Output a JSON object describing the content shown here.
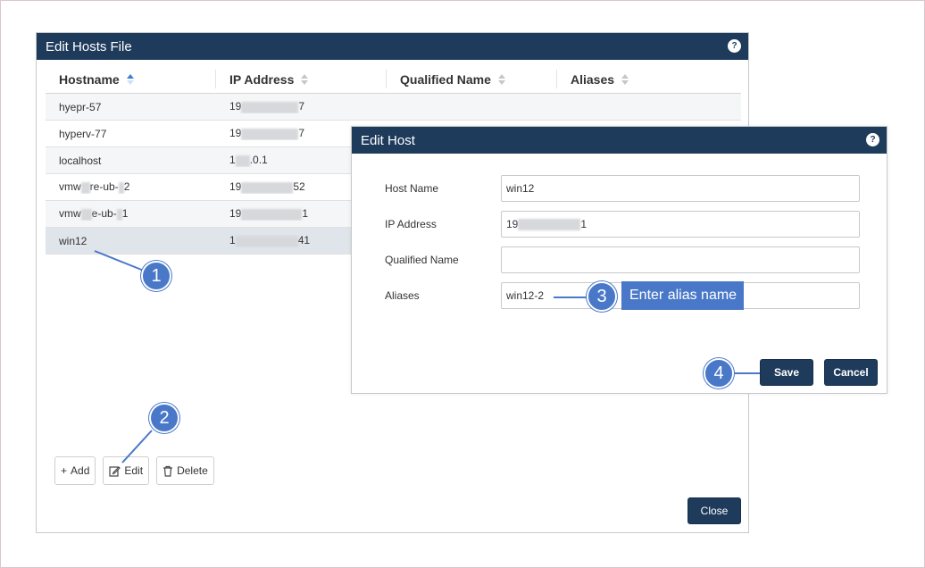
{
  "main_dialog": {
    "title": "Edit Hosts File",
    "help_icon": "?",
    "columns": [
      "Hostname",
      "IP Address",
      "Qualified Name",
      "Aliases"
    ],
    "rows": [
      {
        "hostname": "hyepr-57",
        "ip_prefix": "19",
        "ip_suffix": "7"
      },
      {
        "hostname": "hyperv-77",
        "ip_prefix": "19",
        "ip_suffix": "7"
      },
      {
        "hostname": "localhost",
        "ip_prefix": "1",
        "ip_suffix": ".0.1"
      },
      {
        "hostname_a": "vmw",
        "hostname_b": "re-ub-",
        "hostname_c": "2",
        "ip_prefix": "19",
        "ip_suffix": "52"
      },
      {
        "hostname_a": "vmw",
        "hostname_b": "e-ub-",
        "hostname_c": "1",
        "ip_prefix": "19",
        "ip_suffix": "1"
      },
      {
        "hostname": "win12",
        "ip_prefix": "1",
        "ip_suffix": "41"
      }
    ],
    "toolbar": {
      "add": "Add",
      "edit": "Edit",
      "delete": "Delete"
    },
    "close": "Close"
  },
  "host_dialog": {
    "title": "Edit Host",
    "help_icon": "?",
    "fields": {
      "host_name": {
        "label": "Host Name",
        "value": "win12"
      },
      "ip_address": {
        "label": "IP Address",
        "value_prefix": "19",
        "value_suffix": "1"
      },
      "qualified_name": {
        "label": "Qualified Name",
        "value": ""
      },
      "aliases": {
        "label": "Aliases",
        "value": "win12-2"
      }
    },
    "save": "Save",
    "cancel": "Cancel"
  },
  "callouts": {
    "one": "1",
    "two": "2",
    "three": "3",
    "four": "4",
    "three_label": "Enter alias name"
  },
  "colors": {
    "header": "#1f3b5c",
    "callout": "#4a78c8",
    "selected_row": "#dfe5ea"
  }
}
